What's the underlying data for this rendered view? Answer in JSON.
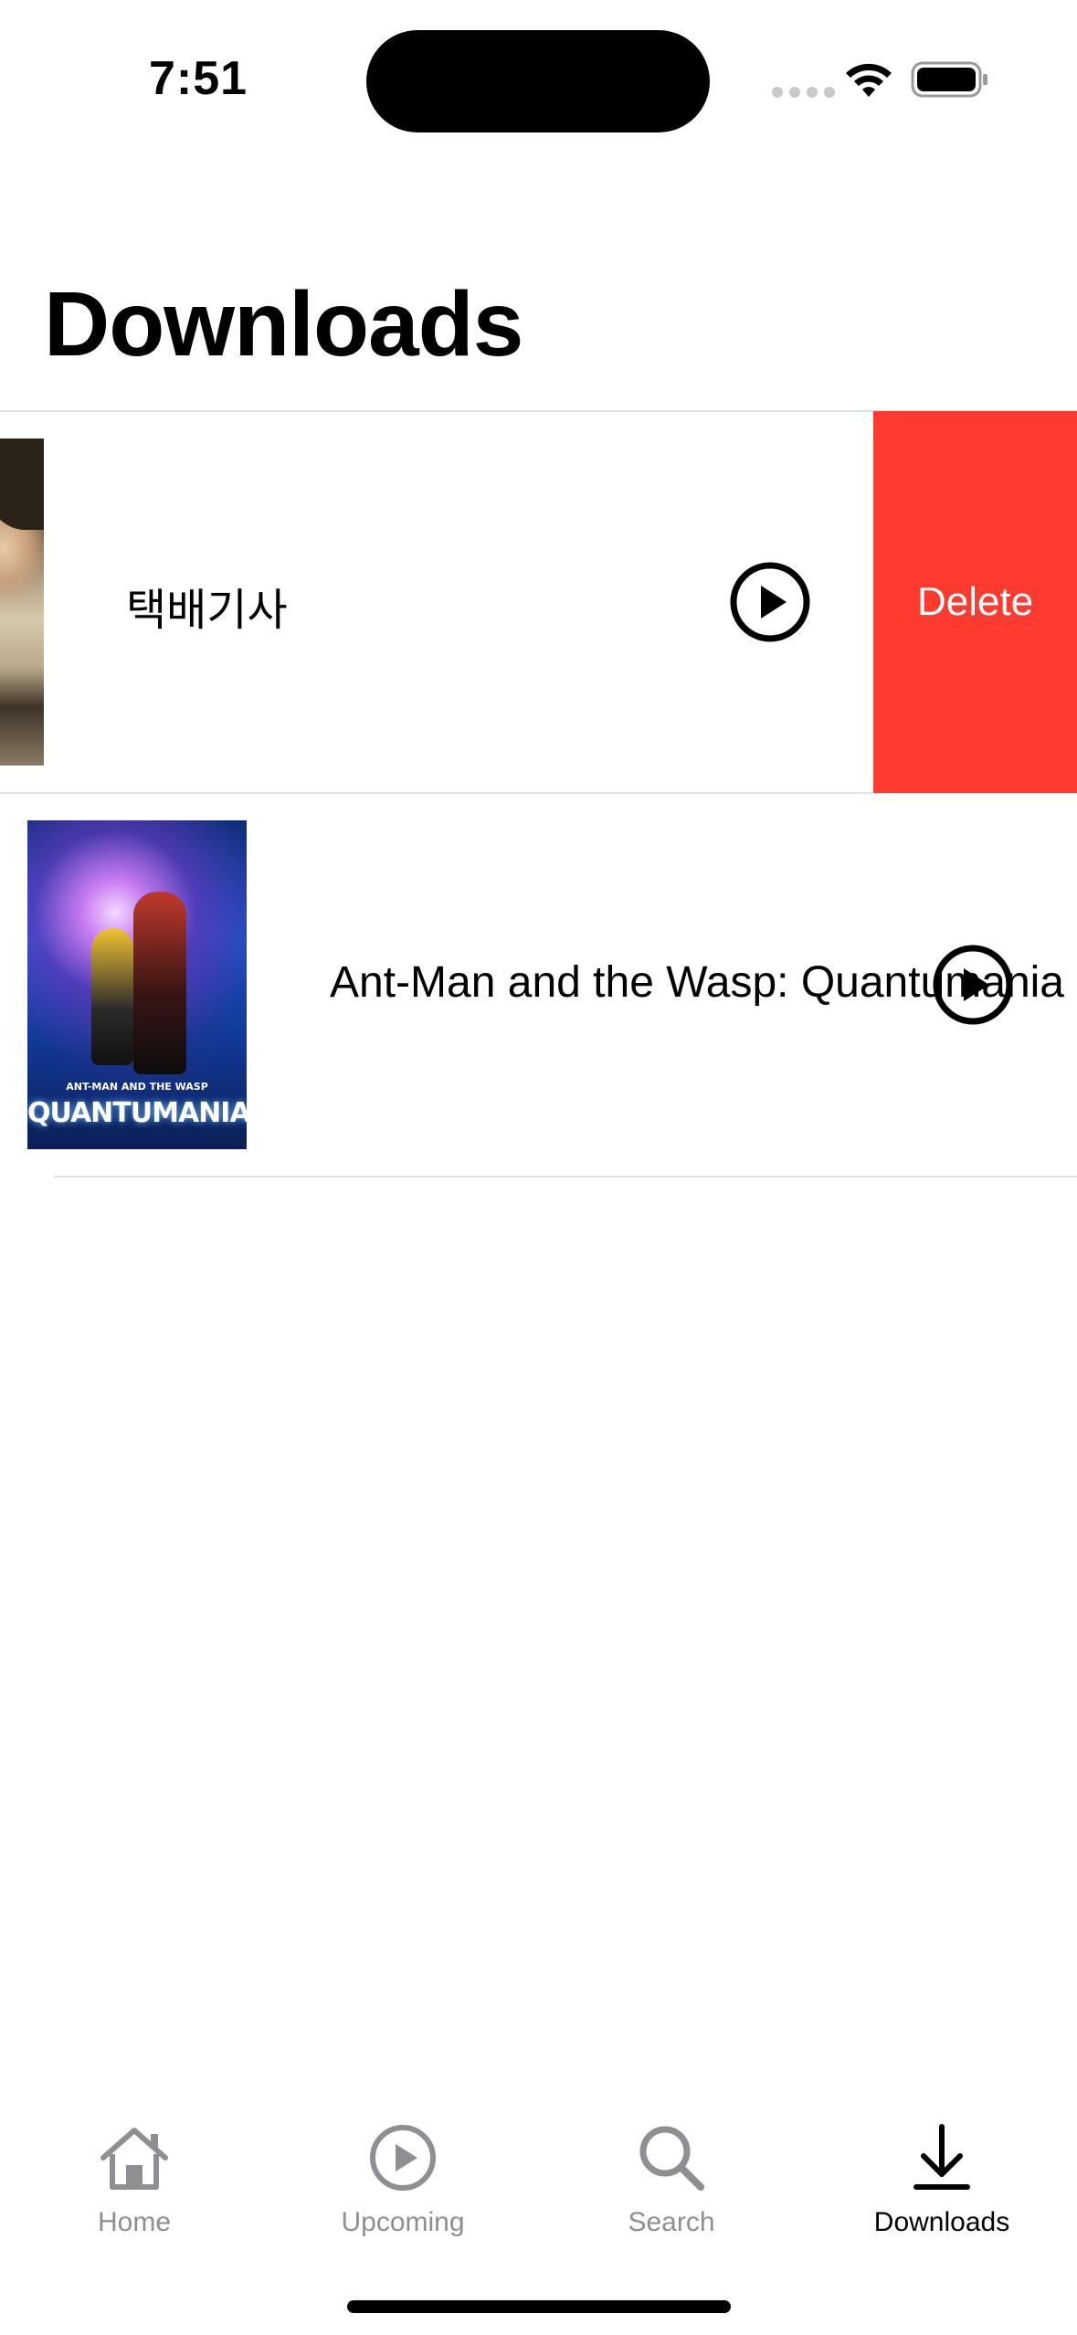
{
  "status_bar": {
    "time": "7:51"
  },
  "page": {
    "title": "Downloads"
  },
  "downloads": [
    {
      "title": "택배기사",
      "swipe_action": "Delete"
    },
    {
      "title": "Ant-Man and the Wasp: Quantumania",
      "poster_text": "QUANTUMANIA",
      "poster_subtext": "ANT-MAN AND THE WASP"
    }
  ],
  "tab_bar": {
    "tabs": [
      {
        "label": "Home",
        "icon": "house-icon",
        "active": false
      },
      {
        "label": "Upcoming",
        "icon": "play-circle-icon",
        "active": false
      },
      {
        "label": "Search",
        "icon": "magnifying-glass-icon",
        "active": false
      },
      {
        "label": "Downloads",
        "icon": "download-arrow-icon",
        "active": true
      }
    ]
  },
  "colors": {
    "delete": "#ff3b30",
    "inactive_tab": "#8e8e93",
    "active_tab": "#000000"
  }
}
